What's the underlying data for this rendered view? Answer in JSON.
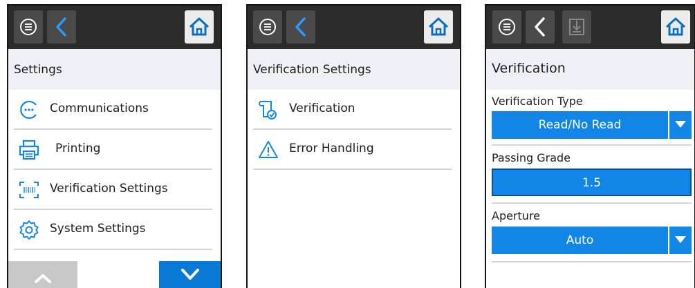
{
  "screens": [
    {
      "title": "Settings",
      "topbar": {
        "menu_icon": "menu-icon",
        "back_icon": "back-icon",
        "home_icon": "home-icon"
      },
      "items": [
        {
          "label": "Communications",
          "icon": "communications-icon"
        },
        {
          "label": "Printing",
          "icon": "printer-icon"
        },
        {
          "label": "Verification Settings",
          "icon": "barcode-scan-icon"
        },
        {
          "label": "System Settings",
          "icon": "gear-icon"
        }
      ],
      "footer": {
        "up_icon": "chevron-up-icon",
        "down_icon": "chevron-down-icon"
      }
    },
    {
      "title": "Verification Settings",
      "topbar": {
        "menu_icon": "menu-icon",
        "back_icon": "back-icon",
        "home_icon": "home-icon"
      },
      "items": [
        {
          "label": "Verification",
          "icon": "verification-icon"
        },
        {
          "label": "Error Handling",
          "icon": "warning-icon"
        }
      ]
    },
    {
      "title": "Verification",
      "topbar": {
        "menu_icon": "menu-icon",
        "back_icon": "back-icon",
        "save_icon": "save-icon",
        "home_icon": "home-icon"
      },
      "fields": [
        {
          "label": "Verification Type",
          "value": "Read/No Read",
          "type": "dropdown"
        },
        {
          "label": "Passing Grade",
          "value": "1.5",
          "type": "input"
        },
        {
          "label": "Aperture",
          "value": "Auto",
          "type": "dropdown"
        }
      ]
    }
  ],
  "colors": {
    "accent": "#1186e6",
    "topbar": "#2b2b2b",
    "title_bg": "#eef0f5"
  }
}
